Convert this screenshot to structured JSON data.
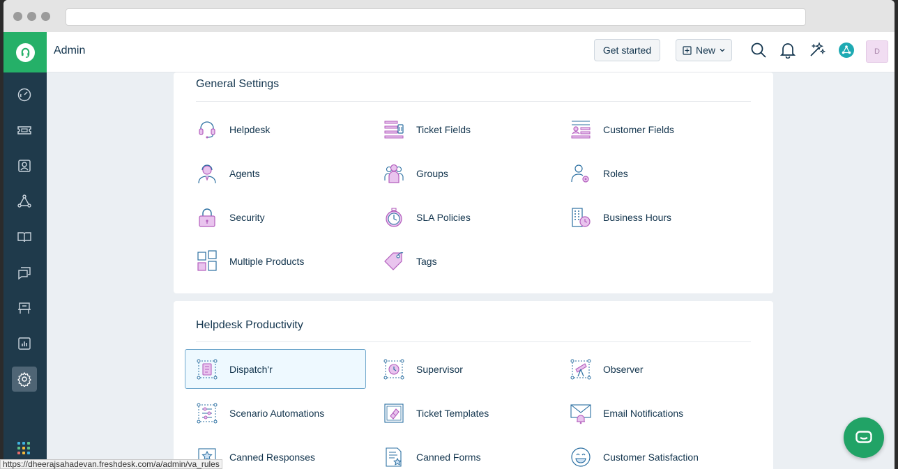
{
  "header": {
    "title": "Admin",
    "get_started_label": "Get started",
    "new_label": "New",
    "avatar_initial": "D"
  },
  "general_settings": {
    "title": "General Settings",
    "items": [
      {
        "label": "Helpdesk",
        "icon": "headset-icon"
      },
      {
        "label": "Ticket Fields",
        "icon": "ticket-fields-icon"
      },
      {
        "label": "Customer Fields",
        "icon": "customer-fields-icon"
      },
      {
        "label": "Agents",
        "icon": "agent-icon"
      },
      {
        "label": "Groups",
        "icon": "groups-icon"
      },
      {
        "label": "Roles",
        "icon": "roles-icon"
      },
      {
        "label": "Security",
        "icon": "lock-icon"
      },
      {
        "label": "SLA Policies",
        "icon": "stopwatch-icon"
      },
      {
        "label": "Business Hours",
        "icon": "building-clock-icon"
      },
      {
        "label": "Multiple Products",
        "icon": "products-grid-icon"
      },
      {
        "label": "Tags",
        "icon": "tag-icon"
      }
    ]
  },
  "helpdesk_productivity": {
    "title": "Helpdesk Productivity",
    "items": [
      {
        "label": "Dispatch'r",
        "icon": "dispatcher-icon",
        "selected": true
      },
      {
        "label": "Supervisor",
        "icon": "supervisor-icon"
      },
      {
        "label": "Observer",
        "icon": "telescope-icon"
      },
      {
        "label": "Scenario Automations",
        "icon": "scenario-icon"
      },
      {
        "label": "Ticket Templates",
        "icon": "ticket-template-icon"
      },
      {
        "label": "Email Notifications",
        "icon": "email-bell-icon"
      },
      {
        "label": "Canned Responses",
        "icon": "canned-responses-icon"
      },
      {
        "label": "Canned Forms",
        "icon": "canned-forms-icon"
      },
      {
        "label": "Customer Satisfaction",
        "icon": "smiley-icon"
      }
    ]
  },
  "status_bar": {
    "url": "https://dheerajsahadevan.freshdesk.com/a/admin/va_rules"
  },
  "colors": {
    "sidebar": "#1f3a4b",
    "brand_green": "#25b068",
    "icon_purple": "#b35fbd",
    "icon_blue": "#2b6fa1",
    "selected_bg": "#eef9ff"
  }
}
